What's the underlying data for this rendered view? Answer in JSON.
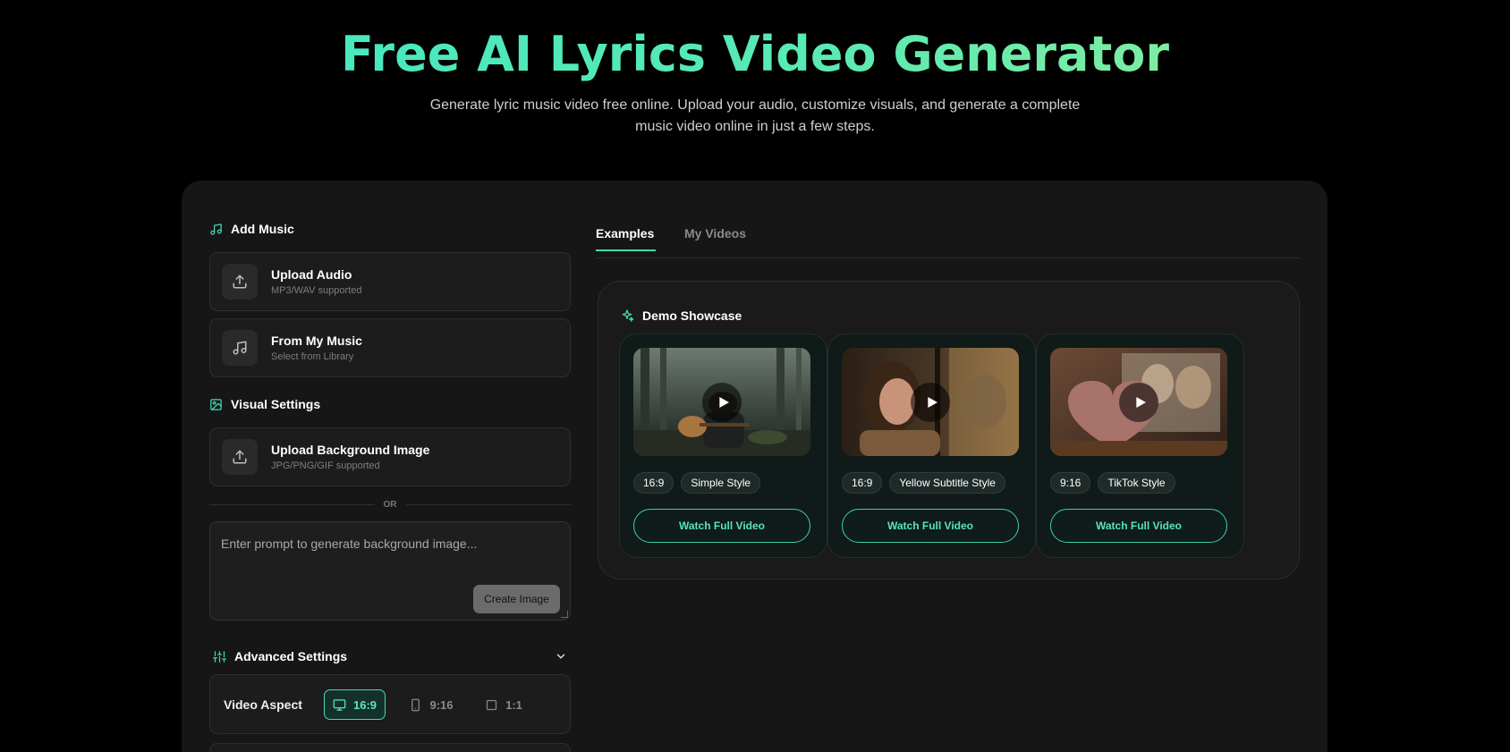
{
  "hero": {
    "title": "Free AI Lyrics Video Generator",
    "subtitle_line1": "Generate lyric music video free online. Upload your audio, customize visuals, and generate a complete",
    "subtitle_line2": "music video online in just a few steps."
  },
  "left": {
    "add_music": {
      "heading": "Add Music",
      "upload_audio": {
        "title": "Upload Audio",
        "sub": "MP3/WAV supported"
      },
      "from_library": {
        "title": "From My Music",
        "sub": "Select from Library"
      }
    },
    "visual": {
      "heading": "Visual Settings",
      "upload_bg": {
        "title": "Upload Background Image",
        "sub": "JPG/PNG/GIF supported"
      },
      "or_label": "OR",
      "prompt_placeholder": "Enter prompt to generate background image...",
      "create_button": "Create Image"
    },
    "advanced": {
      "heading": "Advanced Settings",
      "aspect_label": "Video Aspect",
      "aspect_options": [
        "16:9",
        "9:16",
        "1:1"
      ],
      "aspect_selected": "16:9"
    }
  },
  "right": {
    "tabs": [
      "Examples",
      "My Videos"
    ],
    "active_tab": "Examples",
    "showcase": {
      "heading": "Demo Showcase",
      "cards": [
        {
          "ratio": "16:9",
          "style": "Simple Style",
          "button": "Watch Full Video"
        },
        {
          "ratio": "16:9",
          "style": "Yellow Subtitle Style",
          "button": "Watch Full Video"
        },
        {
          "ratio": "9:16",
          "style": "TikTok Style",
          "button": "Watch Full Video"
        }
      ]
    }
  },
  "colors": {
    "accent": "#3ddcb4",
    "panel": "#161616",
    "background": "#000000"
  }
}
